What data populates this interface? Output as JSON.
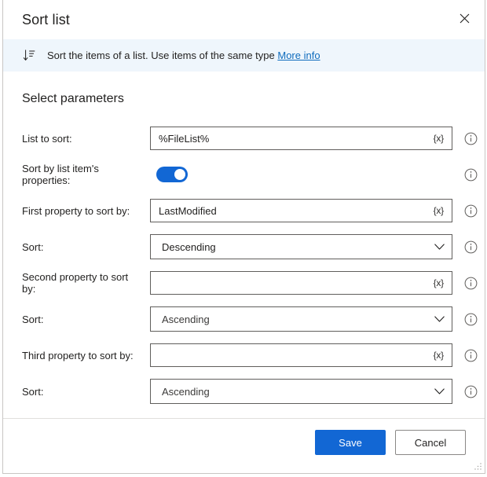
{
  "window": {
    "title": "Sort list",
    "close_icon": "close-icon",
    "resize_grip": "resize-grip"
  },
  "banner": {
    "icon": "sort-descending-icon",
    "text": "Sort the items of a list. Use items of the same type",
    "link_label": "More info",
    "background": "#eff6fc",
    "link_color": "#0f6cbd"
  },
  "main": {
    "section_title": "Select parameters",
    "rows": [
      {
        "label": "List to sort:",
        "control": "textfield",
        "value": "%FileList%",
        "placeholder": "",
        "variable_button": "{x}",
        "info": "info-icon"
      },
      {
        "label": "Sort by list item's properties:",
        "control": "toggle",
        "value": "on",
        "info": "info-icon"
      },
      {
        "label": "First property to sort by:",
        "control": "textfield",
        "value": "LastModified",
        "placeholder": "",
        "variable_button": "{x}",
        "info": "info-icon"
      },
      {
        "label": "Sort:",
        "control": "dropdown",
        "value": "Descending",
        "options": [
          "Ascending",
          "Descending"
        ],
        "info": "info-icon"
      },
      {
        "label": "Second property to sort by:",
        "control": "textfield",
        "value": "",
        "placeholder": "",
        "variable_button": "{x}",
        "info": "info-icon"
      },
      {
        "label": "Sort:",
        "control": "dropdown",
        "value": "Ascending",
        "options": [
          "Ascending",
          "Descending"
        ],
        "info": "info-icon"
      },
      {
        "label": "Third property to sort by:",
        "control": "textfield",
        "value": "",
        "placeholder": "",
        "variable_button": "{x}",
        "info": "info-icon"
      },
      {
        "label": "Sort:",
        "control": "dropdown",
        "value": "Ascending",
        "options": [
          "Ascending",
          "Descending"
        ],
        "info": "info-icon"
      }
    ]
  },
  "footer": {
    "save_label": "Save",
    "cancel_label": "Cancel",
    "primary_color": "#1267d4"
  }
}
